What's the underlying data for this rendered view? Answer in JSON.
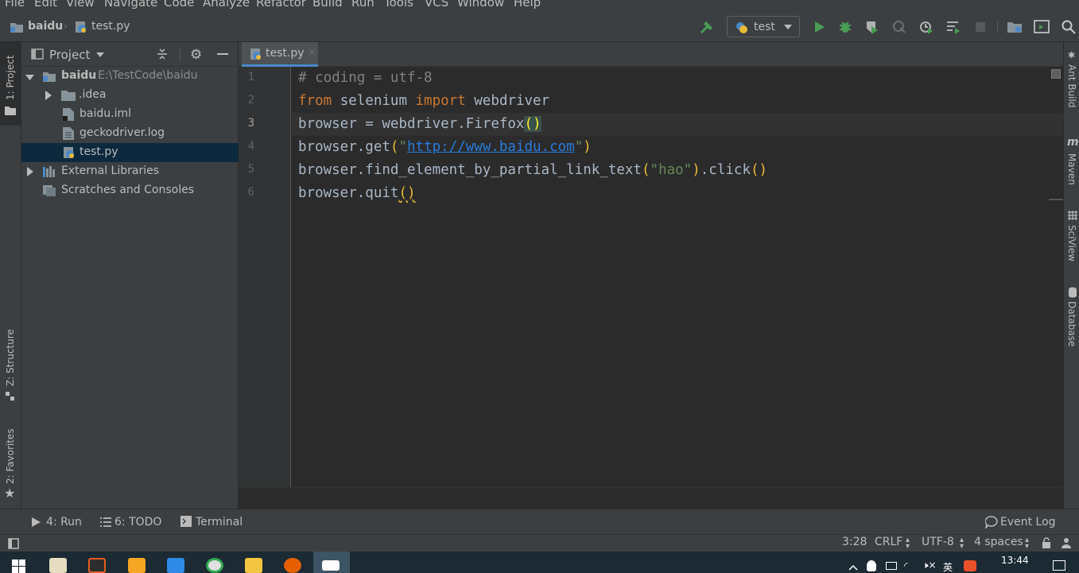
{
  "menu": [
    "File",
    "Edit",
    "View",
    "Navigate",
    "Code",
    "Analyze",
    "Refactor",
    "Build",
    "Run",
    "Tools",
    "VCS",
    "Window",
    "Help"
  ],
  "breadcrumb": {
    "project": "baidu",
    "file": "test.py"
  },
  "run_config": {
    "label": "test"
  },
  "left_tabs": {
    "project": "1: Project",
    "structure": "Z: Structure",
    "favorites": "2: Favorites"
  },
  "right_tabs": {
    "ant": "Ant Build",
    "maven": "Maven",
    "sciview": "SciView",
    "database": "Database"
  },
  "project_panel": {
    "title": "Project",
    "root_name": "baidu",
    "root_path": "E:\\TestCode\\baidu",
    "items": [
      ".idea",
      "baidu.iml",
      "geckodriver.log",
      "test.py",
      "External Libraries",
      "Scratches and Consoles"
    ]
  },
  "editor": {
    "tab": "test.py",
    "current_line": 3,
    "line_numbers": [
      "1",
      "2",
      "3",
      "4",
      "5",
      "6"
    ],
    "lines": {
      "l1": "# coding = utf-8",
      "l2_kw1": "from",
      "l2_mid": " selenium ",
      "l2_kw2": "import",
      "l2_end": " webdriver",
      "l3_pre": "browser = webdriver.Firefox",
      "l3_par": "()",
      "l4_pre": "browser.get",
      "l4_p1": "(",
      "l4_q1": "\"",
      "l4_url": "http://www.baidu.com",
      "l4_q2": "\"",
      "l4_p2": ")",
      "l5_pre": "browser.find_element_by_partial_link_text",
      "l5_p1": "(",
      "l5_str": "\"hao\"",
      "l5_p2": ")",
      "l5_mid": ".click",
      "l5_p3": "()",
      "l6_pre": "browser.quit",
      "l6_par": "()"
    }
  },
  "bottom_tools": {
    "run": "4: Run",
    "todo": "6: TODO",
    "terminal": "Terminal",
    "event_log": "Event Log"
  },
  "status": {
    "position": "3:28",
    "line_sep": "CRLF",
    "encoding": "UTF-8",
    "indent": "4 spaces"
  },
  "taskbar": {
    "time": "13:44",
    "ime": "英"
  },
  "colors": {
    "accent": "#4a88c7",
    "run_green": "#499c54",
    "keyword": "#cc7832",
    "string": "#6a8759",
    "comment": "#808080"
  }
}
